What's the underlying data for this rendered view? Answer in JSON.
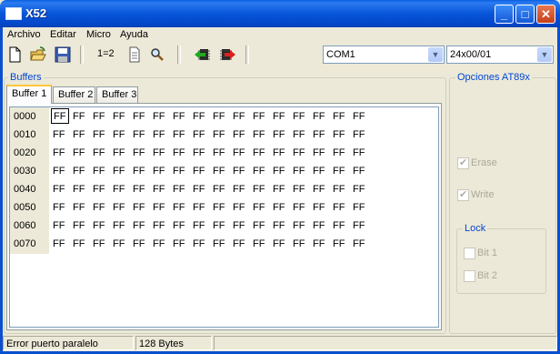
{
  "window": {
    "title": "X52",
    "minimize_glyph": "_",
    "maximize_glyph": "□",
    "close_glyph": "✕"
  },
  "menu": [
    "Archivo",
    "Editar",
    "Micro",
    "Ayuda"
  ],
  "toolbar": {
    "ratio_label": "1=2"
  },
  "port_select": {
    "value": "COM1"
  },
  "device_select": {
    "value": "24x00/01"
  },
  "buffers": {
    "group_label": "Buffers",
    "tabs": [
      "Buffer 1",
      "Buffer 2",
      "Buffer 3"
    ],
    "rows": [
      {
        "address": "0000",
        "bytes": [
          "FF",
          "FF",
          "FF",
          "FF",
          "FF",
          "FF",
          "FF",
          "FF",
          "FF",
          "FF",
          "FF",
          "FF",
          "FF",
          "FF",
          "FF",
          "FF"
        ]
      },
      {
        "address": "0010",
        "bytes": [
          "FF",
          "FF",
          "FF",
          "FF",
          "FF",
          "FF",
          "FF",
          "FF",
          "FF",
          "FF",
          "FF",
          "FF",
          "FF",
          "FF",
          "FF",
          "FF"
        ]
      },
      {
        "address": "0020",
        "bytes": [
          "FF",
          "FF",
          "FF",
          "FF",
          "FF",
          "FF",
          "FF",
          "FF",
          "FF",
          "FF",
          "FF",
          "FF",
          "FF",
          "FF",
          "FF",
          "FF"
        ]
      },
      {
        "address": "0030",
        "bytes": [
          "FF",
          "FF",
          "FF",
          "FF",
          "FF",
          "FF",
          "FF",
          "FF",
          "FF",
          "FF",
          "FF",
          "FF",
          "FF",
          "FF",
          "FF",
          "FF"
        ]
      },
      {
        "address": "0040",
        "bytes": [
          "FF",
          "FF",
          "FF",
          "FF",
          "FF",
          "FF",
          "FF",
          "FF",
          "FF",
          "FF",
          "FF",
          "FF",
          "FF",
          "FF",
          "FF",
          "FF"
        ]
      },
      {
        "address": "0050",
        "bytes": [
          "FF",
          "FF",
          "FF",
          "FF",
          "FF",
          "FF",
          "FF",
          "FF",
          "FF",
          "FF",
          "FF",
          "FF",
          "FF",
          "FF",
          "FF",
          "FF"
        ]
      },
      {
        "address": "0060",
        "bytes": [
          "FF",
          "FF",
          "FF",
          "FF",
          "FF",
          "FF",
          "FF",
          "FF",
          "FF",
          "FF",
          "FF",
          "FF",
          "FF",
          "FF",
          "FF",
          "FF"
        ]
      },
      {
        "address": "0070",
        "bytes": [
          "FF",
          "FF",
          "FF",
          "FF",
          "FF",
          "FF",
          "FF",
          "FF",
          "FF",
          "FF",
          "FF",
          "FF",
          "FF",
          "FF",
          "FF",
          "FF"
        ]
      }
    ]
  },
  "options": {
    "group_label": "Opciones AT89x",
    "erase_label": "Erase",
    "write_label": "Write",
    "lock_label": "Lock",
    "bit1_label": "Bit 1",
    "bit2_label": "Bit 2"
  },
  "status": {
    "message": "Error puerto paralelo",
    "size": "128 Bytes"
  },
  "icons": [
    "new-file-icon",
    "open-folder-icon",
    "save-disk-icon",
    "document-icon",
    "search-icon",
    "chip-read-icon",
    "chip-write-icon",
    "dropdown-arrow-icon",
    "checkmark-icon"
  ]
}
